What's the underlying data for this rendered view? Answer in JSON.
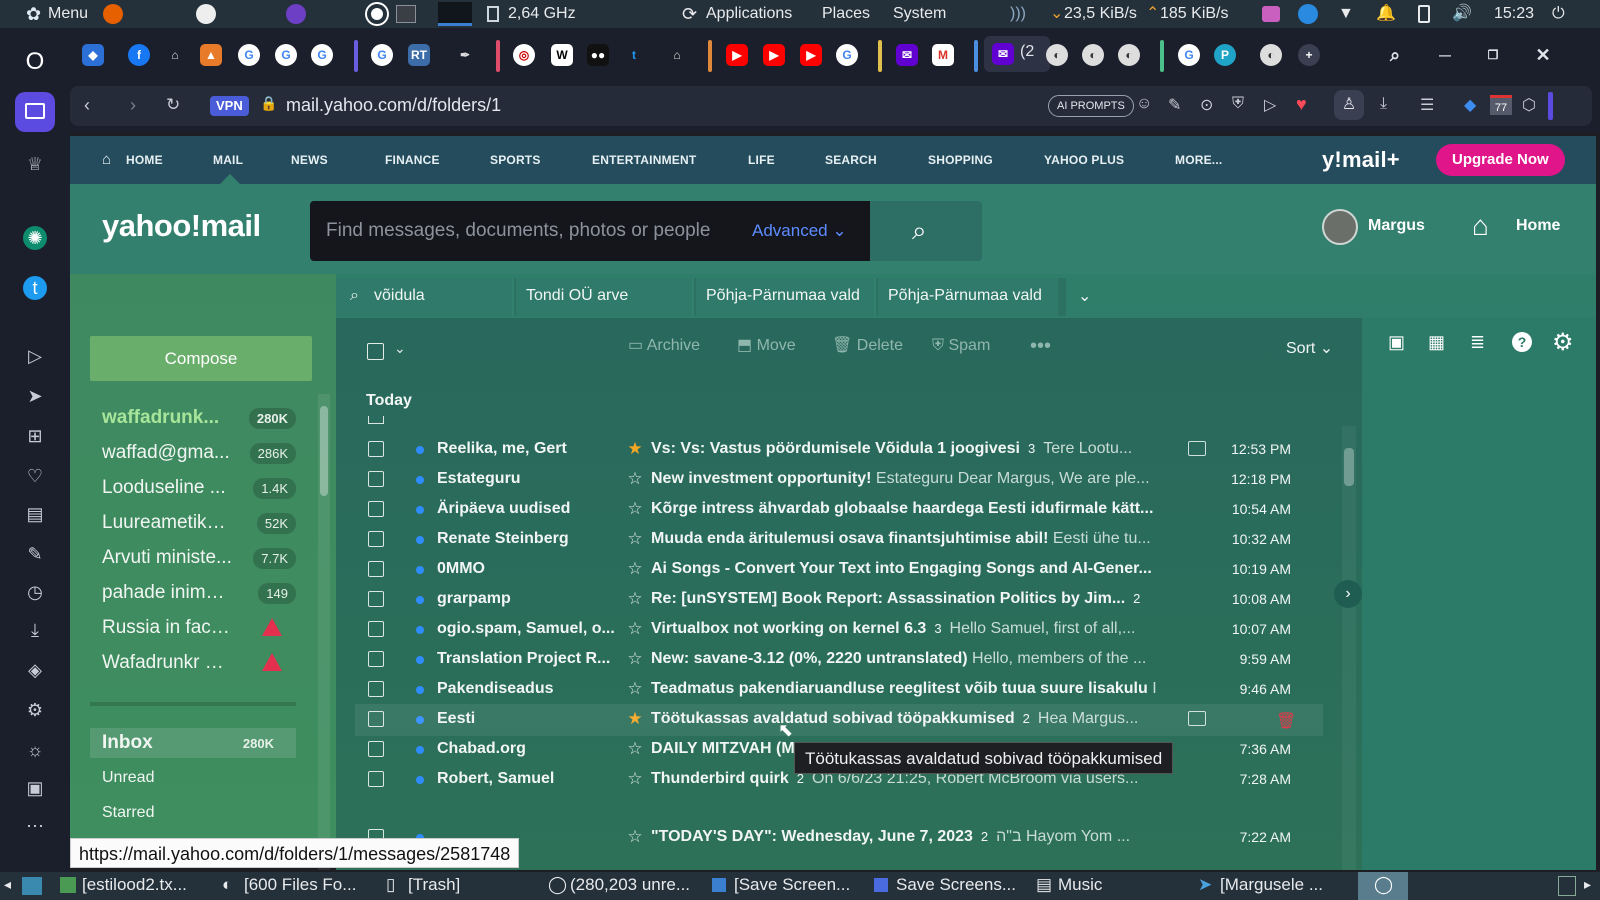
{
  "system_panel": {
    "menu": "Menu",
    "cpu": "2,64 GHz",
    "applications": "Applications",
    "places": "Places",
    "system": "System",
    "net_down": "23,5 KiB/s",
    "net_up": "185 KiB/s",
    "clock": "15:23"
  },
  "tabs": {
    "count_label": "(2"
  },
  "address": {
    "vpn": "VPN",
    "url": "mail.yahoo.com/d/folders/1",
    "ai_prompts": "AI PROMPTS",
    "badge_77": "77"
  },
  "yahoo_nav": {
    "items": [
      "HOME",
      "MAIL",
      "NEWS",
      "FINANCE",
      "SPORTS",
      "ENTERTAINMENT",
      "LIFE",
      "SEARCH",
      "SHOPPING",
      "YAHOO PLUS",
      "MORE..."
    ],
    "logo": "y!mail+",
    "upgrade": "Upgrade Now"
  },
  "header": {
    "logo": "yahoo!mail",
    "search_placeholder": "Find messages, documents, photos or people",
    "advanced": "Advanced",
    "user_name": "Margus",
    "home": "Home"
  },
  "saved_searches": [
    "võidula",
    "Tondi OÜ arve",
    "Põhja-Pärnumaa vald",
    "Põhja-Pärnumaa vald"
  ],
  "compose": "Compose",
  "accounts": [
    {
      "name": "waffadrunk...",
      "count": "280K"
    },
    {
      "name": "waffad@gma...",
      "count": "286K"
    },
    {
      "name": "Looduseline ...",
      "count": "1.4K"
    },
    {
      "name": "Luureametiko...",
      "count": "52K"
    },
    {
      "name": "Arvuti ministe...",
      "count": "7.7K"
    },
    {
      "name": "pahade inimst...",
      "count": "149"
    },
    {
      "name": "Russia in faceb...",
      "count": ""
    },
    {
      "name": "Wafadrunkr wa...",
      "count": ""
    }
  ],
  "folders": [
    {
      "name": "Inbox",
      "count": "280K"
    },
    {
      "name": "Unread",
      "count": ""
    },
    {
      "name": "Starred",
      "count": ""
    }
  ],
  "toolbar": {
    "archive": "Archive",
    "move": "Move",
    "delete": "Delete",
    "spam": "Spam",
    "sort": "Sort",
    "today": "Today"
  },
  "messages": [
    {
      "sender": "Reelika, me, Gert",
      "star": true,
      "subject": "Vs: Vs: Vastus pöördumisele Võidula 1 joogivesi",
      "count": "3",
      "snippet": "Tere Lootu...",
      "att": true,
      "time": "12:53 PM"
    },
    {
      "sender": "Estateguru",
      "star": false,
      "subject": "New investment opportunity!",
      "count": "",
      "snippet": "Estateguru Dear Margus, We are ple...",
      "att": false,
      "time": "12:18 PM"
    },
    {
      "sender": "Äripäeva uudised",
      "star": false,
      "subject": "Kõrge intress ähvardab globaalse haardega Eesti idufirmale kätt...",
      "count": "",
      "snippet": "",
      "att": false,
      "time": "10:54 AM"
    },
    {
      "sender": "Renate Steinberg",
      "star": false,
      "subject": "Muuda enda äritulemusi osava finantsjuhtimise abil!",
      "count": "",
      "snippet": "Eesti ühe tu...",
      "att": false,
      "time": "10:32 AM"
    },
    {
      "sender": "0MMO",
      "star": false,
      "subject": "Ai Songs - Convert Your Text into Engaging Songs and AI-Gener...",
      "count": "",
      "snippet": "",
      "att": false,
      "time": "10:19 AM"
    },
    {
      "sender": "grarpamp",
      "star": false,
      "subject": "Re: [unSYSTEM] Book Report: Assassination Politics by Jim...",
      "count": "2",
      "snippet": "",
      "att": false,
      "time": "10:08 AM"
    },
    {
      "sender": "ogio.spam, Samuel, o...",
      "star": false,
      "subject": "Virtualbox not working on kernel 6.3",
      "count": "3",
      "snippet": "Hello Samuel, first of all,...",
      "att": false,
      "time": "10:07 AM"
    },
    {
      "sender": "Translation Project R...",
      "star": false,
      "subject": "New: savane-3.12 (0%, 2220 untranslated)",
      "count": "",
      "snippet": "Hello, members of the ...",
      "att": false,
      "time": "9:59 AM"
    },
    {
      "sender": "Pakendiseadus",
      "star": false,
      "subject": "Teadmatus pakendiaruandluse reeglitest võib tuua suure lisakulu",
      "count": "",
      "snippet": "I",
      "att": false,
      "time": "9:46 AM"
    },
    {
      "sender": "Eesti",
      "star": true,
      "subject": "Töötukassas avaldatud sobivad tööpakkumised",
      "count": "2",
      "snippet": "Hea Margus...",
      "att": true,
      "time": ""
    },
    {
      "sender": "Chabad.org",
      "star": false,
      "subject": "DAILY MITZVAH (M",
      "count": "",
      "snippet": "",
      "att": false,
      "time": "7:36 AM"
    },
    {
      "sender": "Robert, Samuel",
      "star": false,
      "subject": "Thunderbird quirk",
      "count": "2",
      "snippet": "On 6/6/23 21:25, Robert McBroom via users...",
      "att": false,
      "time": "7:28 AM"
    },
    {
      "sender": "",
      "star": false,
      "subject": "\"TODAY'S DAY\": Wednesday, June 7, 2023",
      "count": "2",
      "snippet": "ב\"ה Hayom Yom ...",
      "att": false,
      "time": "7:22 AM"
    }
  ],
  "tooltip": "Töötukassas avaldatud sobivad tööpakkumised",
  "status_url": "https://mail.yahoo.com/d/folders/1/messages/2581748",
  "taskbar": [
    "[estilood2.tx...",
    "[600 Files Fo...",
    "[Trash]",
    "(280,203 unre...",
    "[Save Screen...",
    "Save Screens...",
    "Music",
    "[Margusele ..."
  ]
}
